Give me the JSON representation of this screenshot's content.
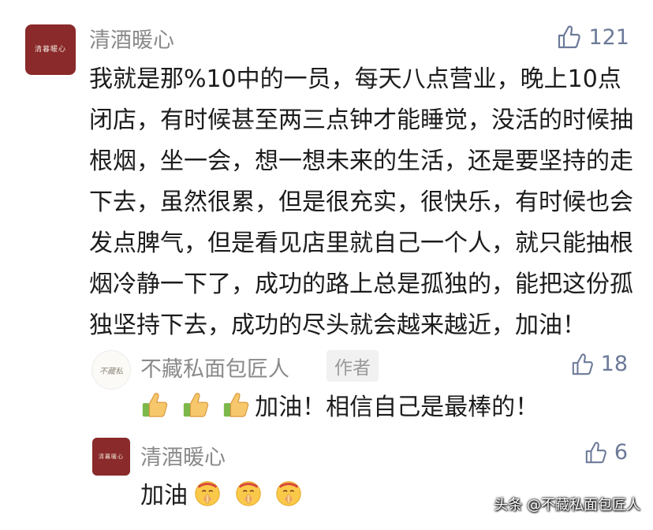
{
  "comment": {
    "user_name": "清酒暖心",
    "avatar_text": "清暮暖心",
    "like_count": "121",
    "text": "我就是那%10中的一员，每天八点营业，晚上10点闭店，有时候甚至两三点钟才能睡觉，没活的时候抽根烟，坐一会，想一想未来的生活，还是要坚持的走下去，虽然很累，但是很充实，很快乐，有时候也会发点脾气，但是看见店里就自己一个人，就只能抽根烟冷静一下了，成功的路上总是孤独的，能把这份孤独坚持下去，成功的尽头就会越来越近，加油！"
  },
  "replies": [
    {
      "user_name": "不藏私面包匠人",
      "avatar_text": "不藏私",
      "badge": "作者",
      "like_count": "18",
      "text": "加油！相信自己是最棒的！",
      "emoji": "thumbs-up-emoji",
      "emoji_count": 3
    },
    {
      "user_name": "清酒暖心",
      "avatar_text": "清暮暖心",
      "like_count": "6",
      "text": "加油",
      "emoji": "shushing-face-emoji",
      "emoji_count": 3
    }
  ],
  "watermark": "头条 @不藏私面包匠人",
  "colors": {
    "avatar_bg": "#8a2a2a",
    "name_gray": "#8a8a8a",
    "like_blue": "#6c7a99",
    "text_dark": "#1c1c1c"
  }
}
